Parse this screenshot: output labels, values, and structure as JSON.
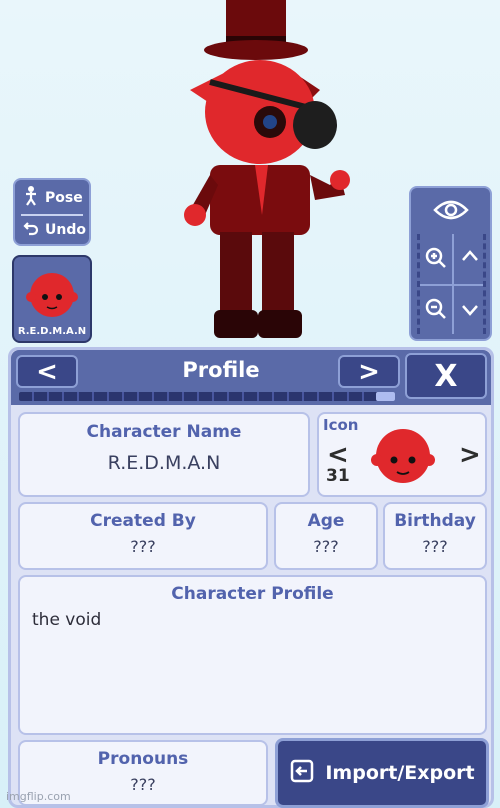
{
  "controls": {
    "pose_label": "Pose",
    "undo_label": "Undo",
    "character_thumb_label": "R.E.D.M.A.N"
  },
  "profile": {
    "title": "Profile",
    "prev_label": "<",
    "next_label": ">",
    "close_label": "X",
    "progress": 0.05,
    "character_name_label": "Character Name",
    "character_name": "R.E.D.M.A.N",
    "icon_label": "Icon",
    "icon_number": "31",
    "icon_prev": "<",
    "icon_next": ">",
    "created_by_label": "Created By",
    "created_by": "???",
    "age_label": "Age",
    "age": "???",
    "birthday_label": "Birthday",
    "birthday": "???",
    "character_profile_label": "Character Profile",
    "character_profile": "the void",
    "pronouns_label": "Pronouns",
    "pronouns": "???",
    "import_export_label": "Import/Export"
  },
  "watermark": "imgflip.com",
  "colors": {
    "accent": "#5a6aa8",
    "accent_dark": "#3a4788",
    "card": "#f2f4fc",
    "label": "#5263ad",
    "character_red": "#e0282c"
  }
}
